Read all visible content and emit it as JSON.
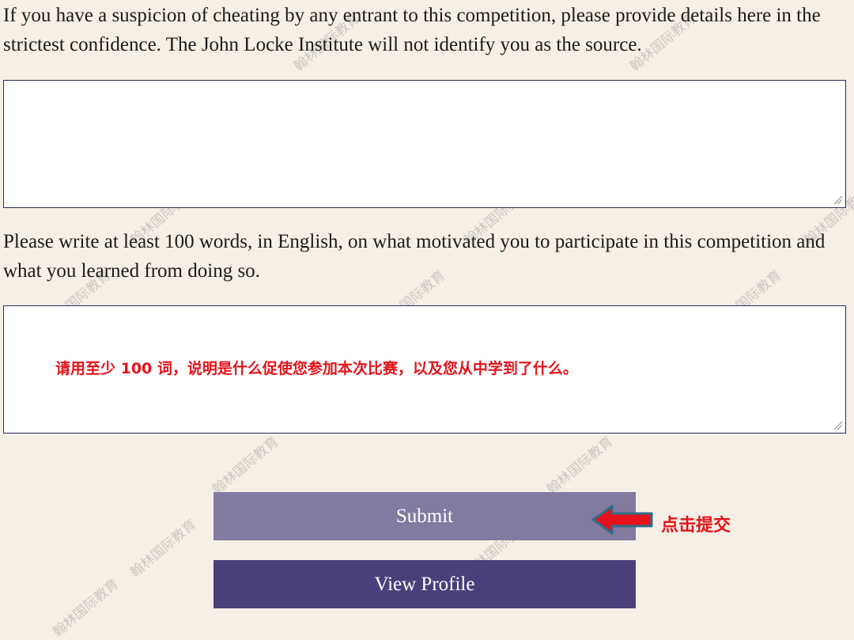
{
  "form": {
    "cheating_prompt": "If you have a suspicion of cheating by any entrant to this competition, please provide details here in the strictest confidence. The John Locke Institute will not identify you as the source.",
    "cheating_value": "",
    "motivation_prompt": "Please write at least 100 words, in English, on what motivated you to participate in this competition and what you learned from doing so.",
    "motivation_value": ""
  },
  "annotations": {
    "motivation_translation": "请用至少 100 词，说明是什么促使您参加本次比赛，以及您从中学到了什么。",
    "submit_hint": "点击提交",
    "accent_color": "#e5121b"
  },
  "buttons": {
    "submit_label": "Submit",
    "submit_color": "#827a9f",
    "view_profile_label": "View Profile",
    "view_profile_color": "#4a3f7b"
  },
  "watermark": {
    "text": "翰林国际教育"
  }
}
